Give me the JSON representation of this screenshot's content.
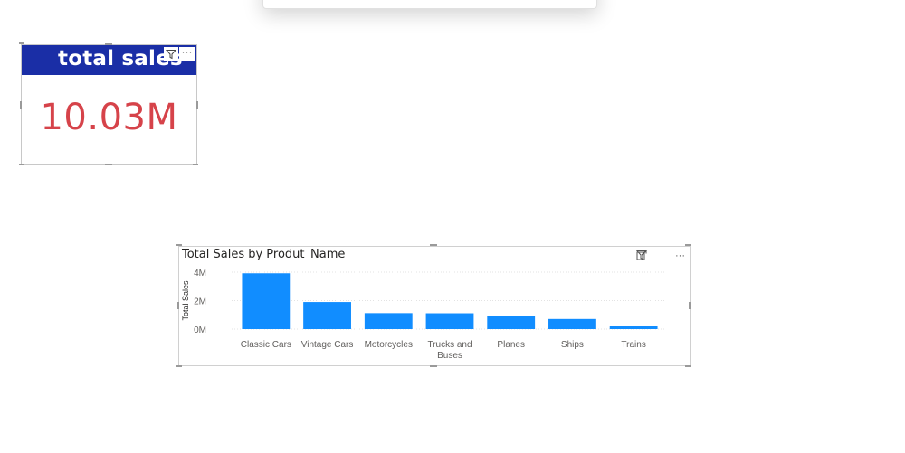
{
  "card": {
    "title": "total sales",
    "value": "10.03M",
    "more_label": "···"
  },
  "chart": {
    "more_label": "···"
  },
  "colors": {
    "card_header": "#1a2ea6",
    "card_value": "#d6434a",
    "bar": "#118dff"
  },
  "chart_data": {
    "type": "bar",
    "title": "Total Sales by Produt_Name",
    "xlabel": "",
    "ylabel": "Total Sales",
    "categories": [
      "Classic Cars",
      "Vintage Cars",
      "Motorcycles",
      "Trucks and Buses",
      "Planes",
      "Ships",
      "Trains"
    ],
    "category_lines": [
      [
        "Classic Cars"
      ],
      [
        "Vintage Cars"
      ],
      [
        "Motorcycles"
      ],
      [
        "Trucks and",
        "Buses"
      ],
      [
        "Planes"
      ],
      [
        "Ships"
      ],
      [
        "Trains"
      ]
    ],
    "values": [
      3.92,
      1.9,
      1.12,
      1.11,
      0.95,
      0.71,
      0.23
    ],
    "ylim": [
      0,
      4
    ],
    "yticks": [
      0,
      2,
      4
    ],
    "ytick_labels": [
      "0M",
      "2M",
      "4M"
    ],
    "grid": true
  }
}
